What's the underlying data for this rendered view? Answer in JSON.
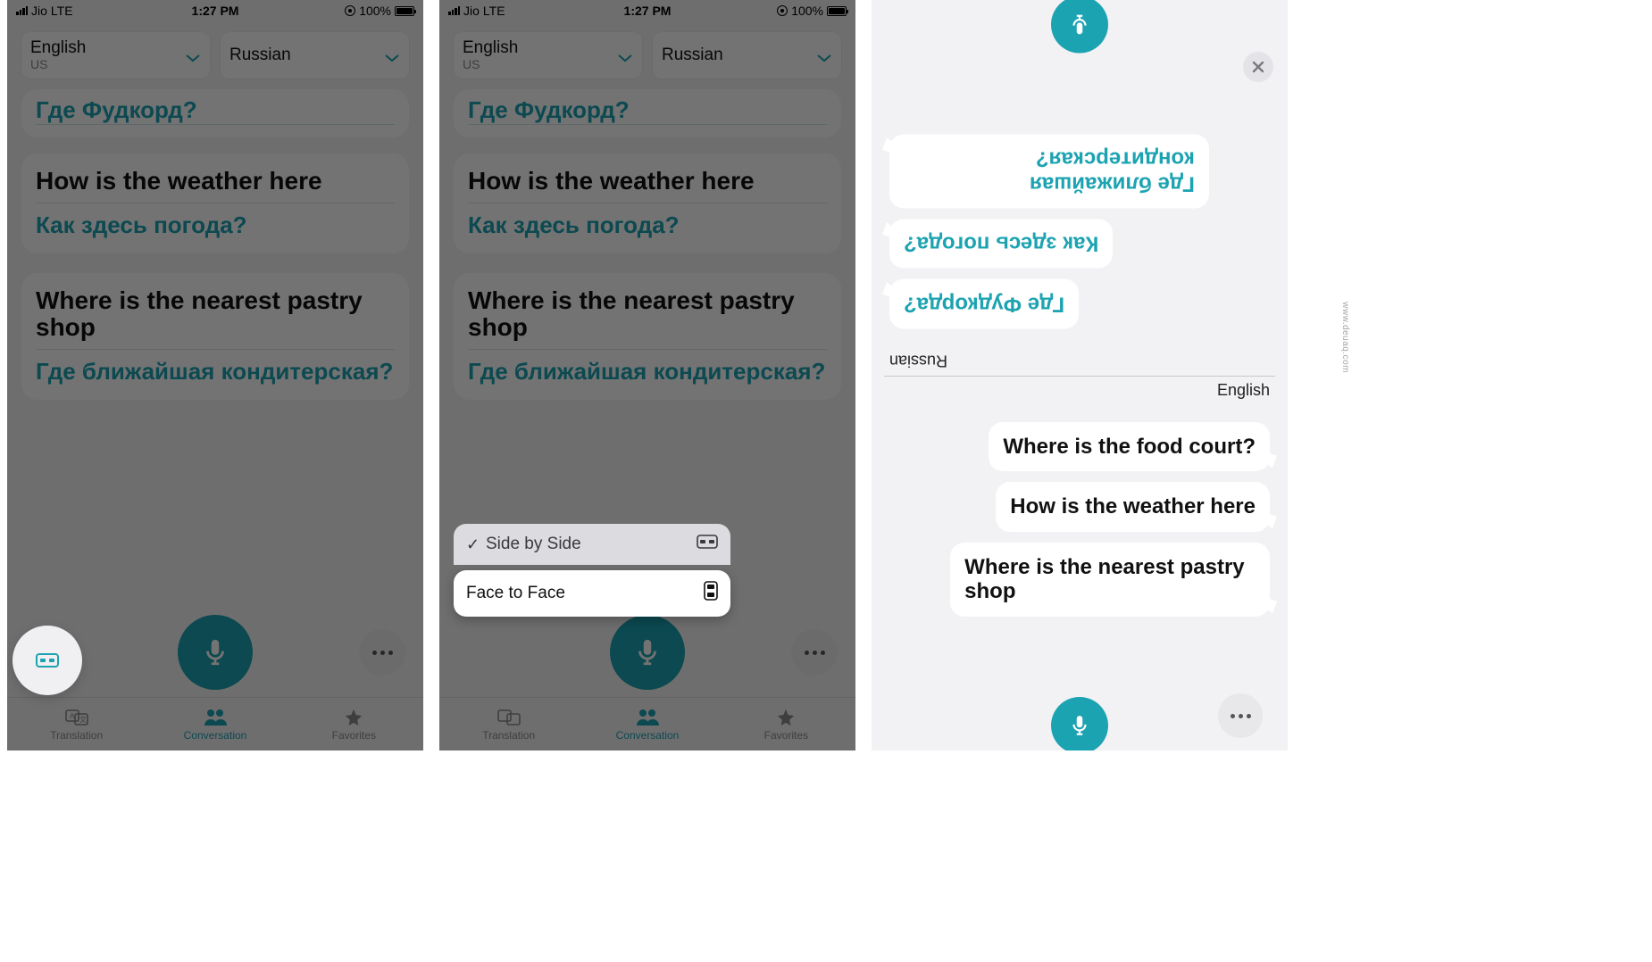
{
  "statusbar": {
    "carrier": "Jio",
    "network": "LTE",
    "time": "1:27 PM",
    "battery": "100%"
  },
  "languages": {
    "left": {
      "name": "English",
      "region": "US"
    },
    "right": {
      "name": "Russian",
      "region": ""
    }
  },
  "partial_translation": "Где Фудкорд?",
  "conversation": [
    {
      "src": "How is the weather here",
      "trg": "Как здесь погода?"
    },
    {
      "src": "Where is the nearest pastry shop",
      "trg": "Где ближайшая кондитерская?"
    }
  ],
  "view_menu": {
    "option_a": "Side by Side",
    "option_b": "Face to Face"
  },
  "tabs": {
    "translation": "Translation",
    "conversation": "Conversation",
    "favorites": "Favorites"
  },
  "face_to_face": {
    "top_lang": "Russian",
    "bottom_lang": "English",
    "russian_msgs": [
      "Где ближайшая кондитерская?",
      "Как здесь погода?",
      "Где Фудкорда?"
    ],
    "english_msgs": [
      "Where is the food court?",
      "How is the weather here",
      "Where is the nearest pastry shop"
    ]
  },
  "watermark": "www.deuaq.com"
}
